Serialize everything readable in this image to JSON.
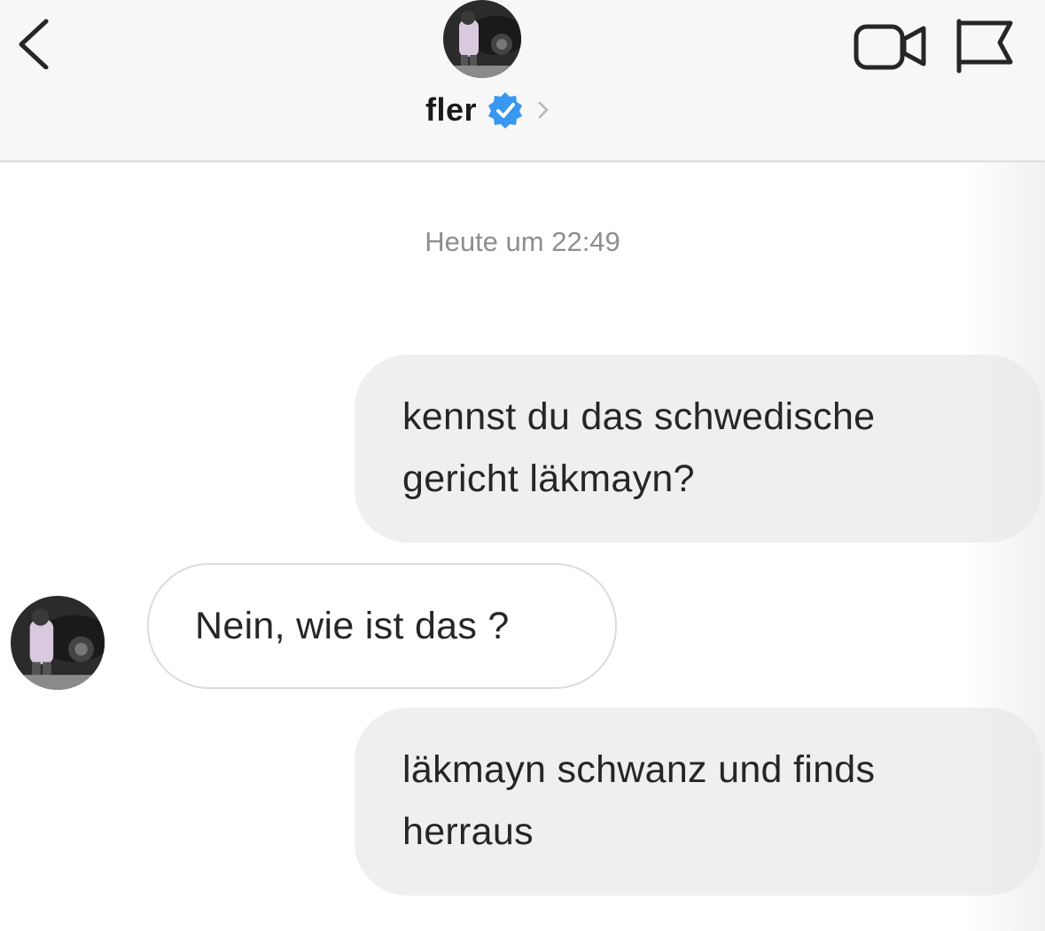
{
  "header": {
    "back_icon": "chevron-left-icon",
    "username": "fler",
    "verified_icon": "verified-badge-icon",
    "profile_chevron_icon": "chevron-right-icon",
    "video_call_icon": "video-camera-icon",
    "report_icon": "flag-icon",
    "colors": {
      "background": "#f7f7f7",
      "verified_blue": "#3897f0"
    }
  },
  "thread": {
    "timestamp": "Heute um 22:49",
    "messages": [
      {
        "direction": "outgoing",
        "lines": [
          "kennst du das schwedische",
          "gericht läkmayn?"
        ]
      },
      {
        "direction": "incoming",
        "lines": [
          "Nein, wie ist das ?"
        ]
      },
      {
        "direction": "outgoing",
        "lines": [
          "läkmayn schwanz und finds",
          "herraus"
        ]
      }
    ],
    "colors": {
      "outgoing_bubble": "#efefef",
      "incoming_border": "#dbdbdb",
      "text": "#262626",
      "timestamp": "#8e8e8e"
    }
  }
}
